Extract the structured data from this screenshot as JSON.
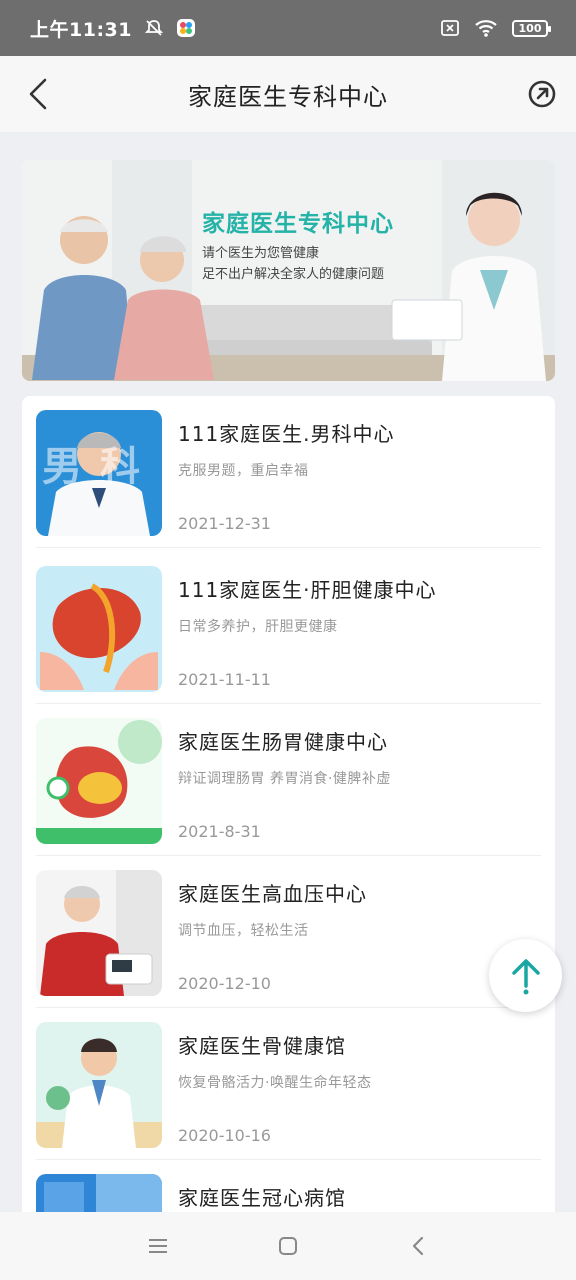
{
  "status_bar": {
    "time": "上午11:31",
    "battery": "100"
  },
  "header": {
    "title": "家庭医生专科中心"
  },
  "banner": {
    "title": "家庭医生专科中心",
    "line1": "请个医生为您管健康",
    "line2": "足不出户解决全家人的健康问题"
  },
  "list": {
    "items": [
      {
        "name": "111家庭医生.男科中心",
        "desc": "克服男题，重启幸福",
        "date": "2021-12-31",
        "thumb_text": "男科"
      },
      {
        "name": "111家庭医生·肝胆健康中心",
        "desc": "日常多养护，肝胆更健康",
        "date": "2021-11-11"
      },
      {
        "name": "家庭医生肠胃健康中心",
        "desc": "辩证调理肠胃 养胃消食·健脾补虚",
        "date": "2021-8-31"
      },
      {
        "name": "家庭医生高血压中心",
        "desc": "调节血压，轻松生活",
        "date": "2020-12-10"
      },
      {
        "name": "家庭医生骨健康馆",
        "desc": "恢复骨骼活力·唤醒生命年轻态",
        "date": "2020-10-16"
      },
      {
        "name": "家庭医生冠心病馆",
        "desc": "",
        "date": ""
      }
    ]
  },
  "icons": {
    "back": "chevron-left-icon",
    "share": "share-icon",
    "scroll_top": "arrow-up-icon",
    "nav_menu": "menu-icon",
    "nav_home": "home-icon",
    "nav_back": "back-icon"
  },
  "colors": {
    "accent": "#25b3a8",
    "fab_arrow": "#1aa7a4",
    "background": "#eeeff3"
  }
}
